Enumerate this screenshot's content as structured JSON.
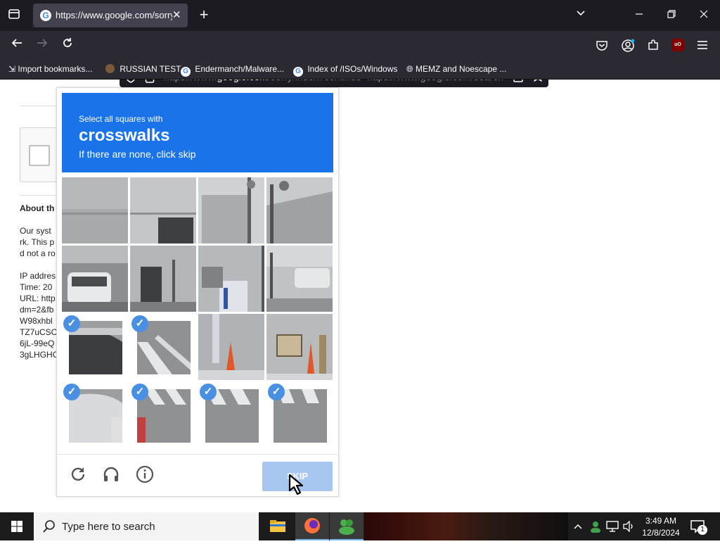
{
  "browser": {
    "tab_title": "https://www.google.com/sorry/index?continue=https://www.google.com/search",
    "url_prefix": "https://www.",
    "url_host": "google.com",
    "url_rest": "/sorry/index?continue=https://www.google.com/search",
    "bookmarks": [
      {
        "label": "Import bookmarks..."
      },
      {
        "label": "RUSSIAN TEST"
      },
      {
        "label": "Endermanch/Malware..."
      },
      {
        "label": "Index of /ISOs/Windows"
      },
      {
        "label": "MEMZ and Noescape ..."
      }
    ]
  },
  "page": {
    "heading": "About th",
    "lines": [
      "Our syst",
      "rk. This p",
      "d not a ro",
      "",
      "IP addres",
      "Time: 20",
      "URL: http",
      "dm=2&fb",
      "W98xhbl",
      "TZ7uCSC",
      "6jL-99eQ",
      "3gLHGHC"
    ]
  },
  "captcha": {
    "instruction_small": "Select all squares with",
    "target": "crosswalks",
    "instruction_sub": "If there are none, click skip",
    "skip_label": "SKIP",
    "tiles": [
      {
        "selected": false
      },
      {
        "selected": false
      },
      {
        "selected": false
      },
      {
        "selected": false
      },
      {
        "selected": false
      },
      {
        "selected": false
      },
      {
        "selected": false
      },
      {
        "selected": false
      },
      {
        "selected": true
      },
      {
        "selected": true
      },
      {
        "selected": false
      },
      {
        "selected": false
      },
      {
        "selected": true
      },
      {
        "selected": true
      },
      {
        "selected": true
      },
      {
        "selected": true
      }
    ]
  },
  "taskbar": {
    "search_placeholder": "Type here to search",
    "time": "3:49 AM",
    "date": "12/8/2024",
    "notification_count": "1"
  },
  "colors": {
    "captcha_blue": "#1a73e8",
    "check_blue": "#4a90e2",
    "skip_disabled": "#a8c7f0"
  }
}
